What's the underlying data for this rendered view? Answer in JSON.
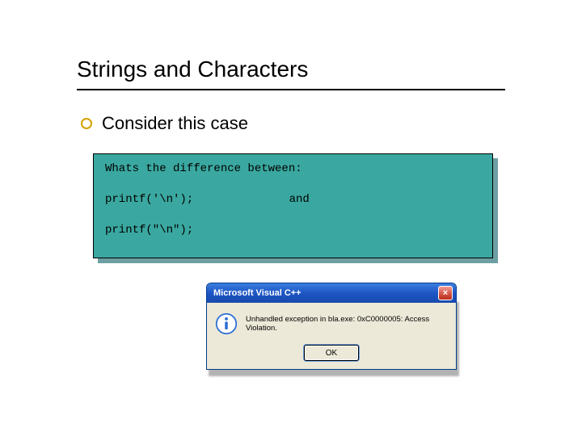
{
  "title": "Strings and Characters",
  "bullet": "Consider this case",
  "code": {
    "intro": "Whats the difference between:",
    "line_a": "printf('\\n');",
    "between": "and",
    "line_b": "printf(\"\\n\");"
  },
  "dialog": {
    "title": "Microsoft Visual C++",
    "message": "Unhandled exception in bla.exe: 0xC0000005: Access Violation.",
    "ok_label": "OK",
    "close_label": "×"
  }
}
